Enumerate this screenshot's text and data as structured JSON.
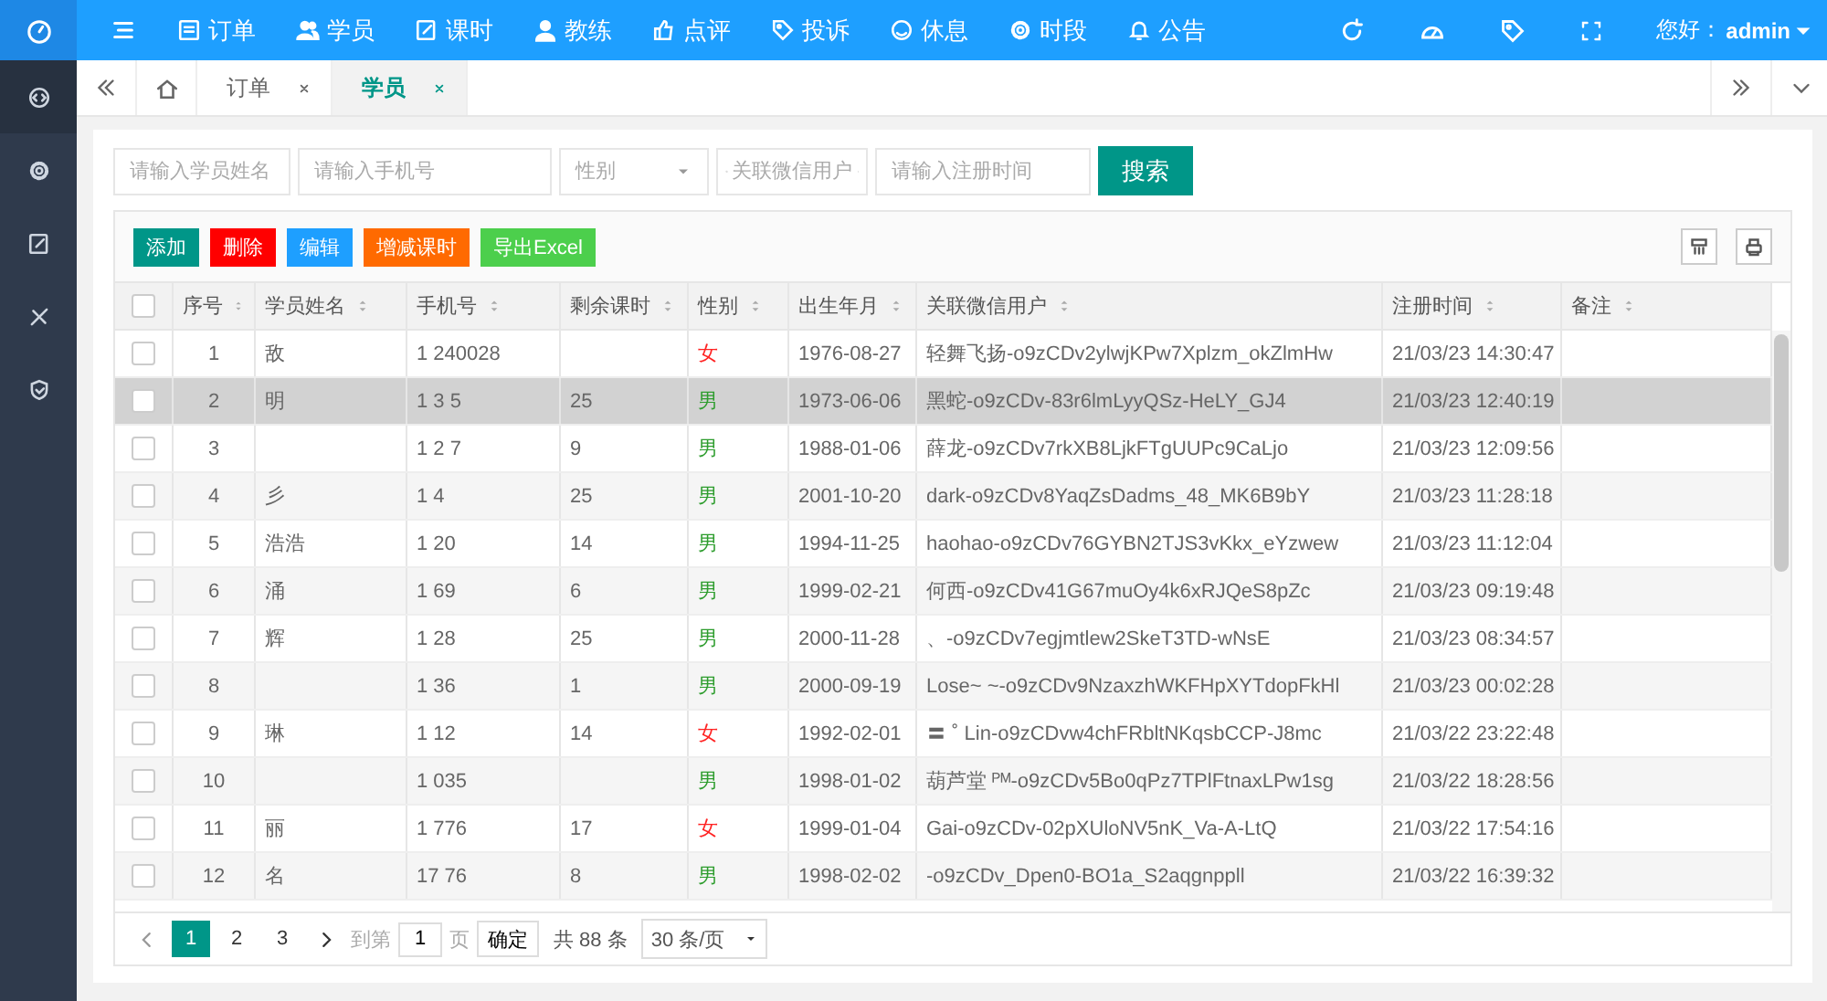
{
  "topbar": {
    "nav": [
      {
        "label": "订单"
      },
      {
        "label": "学员"
      },
      {
        "label": "课时"
      },
      {
        "label": "教练"
      },
      {
        "label": "点评"
      },
      {
        "label": "投诉"
      },
      {
        "label": "休息"
      },
      {
        "label": "时段"
      },
      {
        "label": "公告"
      }
    ],
    "greeting": "您好：",
    "user": "admin"
  },
  "tabs": [
    {
      "label": "订单",
      "selected": false
    },
    {
      "label": "学员",
      "selected": true
    }
  ],
  "search": {
    "fields": [
      {
        "kind": "input",
        "placeholder": "请输入学员姓名"
      },
      {
        "kind": "input",
        "placeholder": "请输入手机号"
      },
      {
        "kind": "select",
        "placeholder": "性别"
      },
      {
        "kind": "search-select",
        "placeholder": "关联微信用户"
      },
      {
        "kind": "input",
        "placeholder": "请输入注册时间"
      }
    ],
    "button": "搜索"
  },
  "toolbar": [
    {
      "label": "添加",
      "color": "#009688"
    },
    {
      "label": "删除",
      "color": "#ff0000"
    },
    {
      "label": "编辑",
      "color": "#1e9fff"
    },
    {
      "label": "增减课时",
      "color": "#ff6a00"
    },
    {
      "label": "导出Excel",
      "color": "#4ccf4c"
    }
  ],
  "table": {
    "select_all": {
      "checked": false
    },
    "columns": [
      "序号",
      "学员姓名",
      "手机号",
      "剩余课时",
      "性别",
      "出生年月",
      "关联微信用户",
      "注册时间",
      "备注"
    ],
    "rows": [
      {
        "checked": false,
        "no": "1",
        "name": "敌",
        "phone": "1 240028",
        "hours": "",
        "gender": "女",
        "female": true,
        "birth": "1976-08-27",
        "wechat": "轻舞飞扬-o9zCDv2ylwjKPw7Xplzm_okZlmHw",
        "time": "21/03/23 14:30:47",
        "selected": false
      },
      {
        "checked": false,
        "no": "2",
        "name": "明",
        "phone": "1 3 5",
        "hours": "25",
        "gender": "男",
        "female": false,
        "birth": "1973-06-06",
        "wechat": "黑蛇-o9zCDv-83r6lmLyyQSz-HeLY_GJ4",
        "time": "21/03/23 12:40:19",
        "selected": true
      },
      {
        "checked": false,
        "no": "3",
        "name": "",
        "phone": "1 2 7",
        "hours": "9",
        "gender": "男",
        "female": false,
        "birth": "1988-01-06",
        "wechat": "薛龙-o9zCDv7rkXB8LjkFTgUUPc9CaLjo",
        "time": "21/03/23 12:09:56",
        "selected": false
      },
      {
        "checked": false,
        "no": "4",
        "name": "彡",
        "phone": "1 4",
        "hours": "25",
        "gender": "男",
        "female": false,
        "birth": "2001-10-20",
        "wechat": "dark-o9zCDv8YaqZsDadms_48_MK6B9bY",
        "time": "21/03/23 11:28:18",
        "selected": false
      },
      {
        "checked": false,
        "no": "5",
        "name": "浩浩",
        "phone": "1 20",
        "hours": "14",
        "gender": "男",
        "female": false,
        "birth": "1994-11-25",
        "wechat": "haohao-o9zCDv76GYBN2TJS3vKkx_eYzwew",
        "time": "21/03/23 11:12:04",
        "selected": false
      },
      {
        "checked": false,
        "no": "6",
        "name": "涌",
        "phone": "1 69",
        "hours": "6",
        "gender": "男",
        "female": false,
        "birth": "1999-02-21",
        "wechat": "何西-o9zCDv41G67muOy4k6xRJQeS8pZc",
        "time": "21/03/23 09:19:48",
        "selected": false
      },
      {
        "checked": false,
        "no": "7",
        "name": "辉",
        "phone": "1 28",
        "hours": "25",
        "gender": "男",
        "female": false,
        "birth": "2000-11-28",
        "wechat": "、-o9zCDv7egjmtlew2SkeT3TD-wNsE",
        "time": "21/03/23 08:34:57",
        "selected": false
      },
      {
        "checked": false,
        "no": "8",
        "name": "",
        "phone": "1 36",
        "hours": "1",
        "gender": "男",
        "female": false,
        "birth": "2000-09-19",
        "wechat": "Lose~ ~-o9zCDv9NzaxzhWKFHpXYTdopFkHl",
        "time": "21/03/23 00:02:28",
        "selected": false
      },
      {
        "checked": false,
        "no": "9",
        "name": "琳",
        "phone": "1 12",
        "hours": "14",
        "gender": "女",
        "female": true,
        "birth": "1992-02-01",
        "wechat": "〓 ˚ Lin-o9zCDvw4chFRbltNKqsbCCP-J8mc",
        "time": "21/03/22 23:22:48",
        "selected": false
      },
      {
        "checked": false,
        "no": "10",
        "name": "",
        "phone": "1 035",
        "hours": "",
        "gender": "男",
        "female": false,
        "birth": "1998-01-02",
        "wechat": "葫芦堂 ᴾᴹ-o9zCDv5Bo0qPz7TPlFtnaxLPw1sg",
        "time": "21/03/22 18:28:56",
        "selected": false
      },
      {
        "checked": false,
        "no": "11",
        "name": "丽",
        "phone": "1 776",
        "hours": "17",
        "gender": "女",
        "female": true,
        "birth": "1999-01-04",
        "wechat": "Gai-o9zCDv-02pXUloNV5nK_Va-A-LtQ",
        "time": "21/03/22 17:54:16",
        "selected": false
      },
      {
        "checked": false,
        "no": "12",
        "name": "名",
        "phone": "17 76",
        "hours": "8",
        "gender": "男",
        "female": false,
        "birth": "1998-02-02",
        "wechat": "-o9zCDv_Dpen0-BO1a_S2aqgnppll",
        "time": "21/03/22 16:39:32",
        "selected": false
      }
    ]
  },
  "pager": {
    "pages": [
      {
        "label": "1",
        "selected": true
      },
      {
        "label": "2",
        "selected": false
      },
      {
        "label": "3",
        "selected": false
      }
    ],
    "goto": "到第",
    "page_value": "1",
    "page_unit": "页",
    "confirm": "确定",
    "total": "共 88 条",
    "page_size": "30 条/页"
  }
}
